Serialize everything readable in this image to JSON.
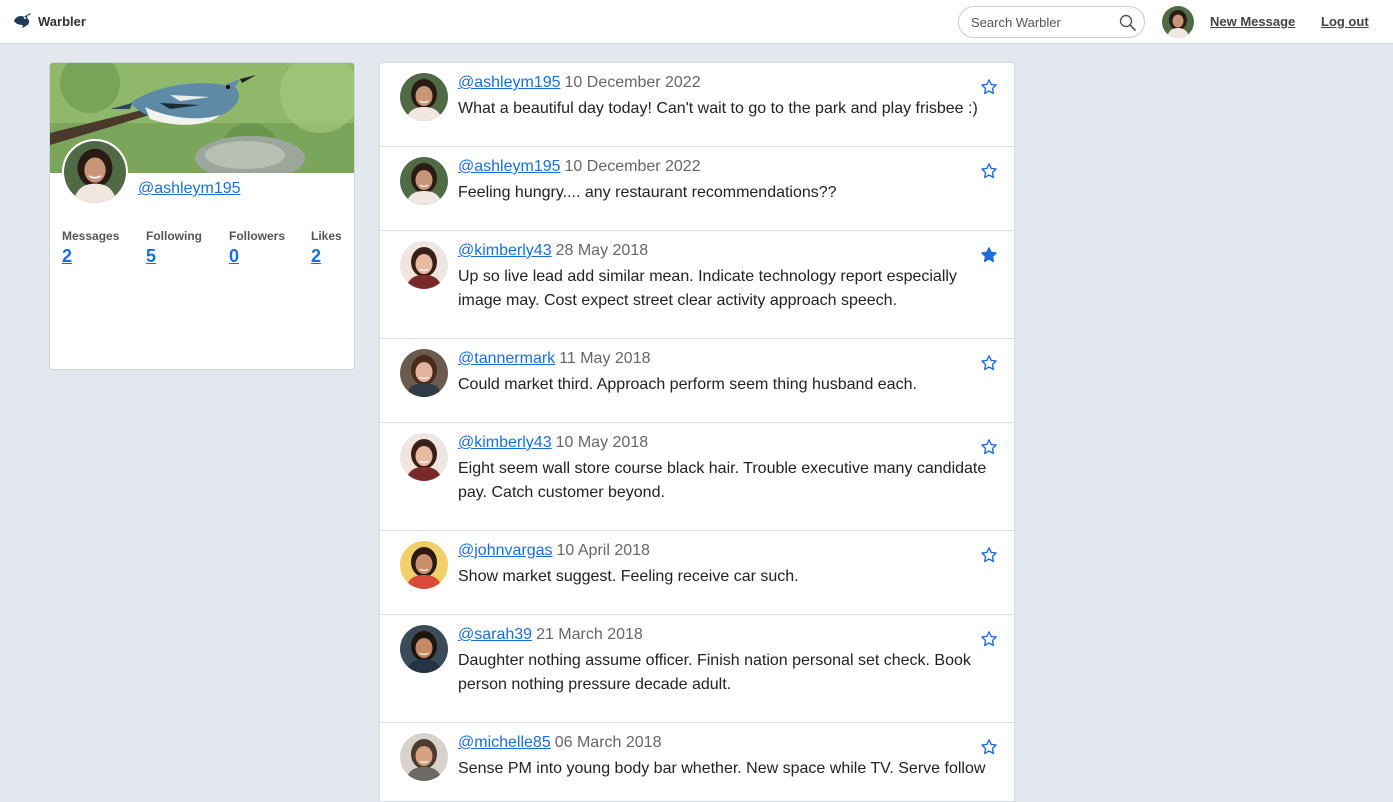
{
  "app": {
    "name": "Warbler"
  },
  "navbar": {
    "search_placeholder": "Search Warbler",
    "new_message": "New Message",
    "logout": "Log out"
  },
  "profile": {
    "username": "@ashleym195",
    "stats": [
      {
        "label": "Messages",
        "value": "2"
      },
      {
        "label": "Following",
        "value": "5"
      },
      {
        "label": "Followers",
        "value": "0"
      },
      {
        "label": "Likes",
        "value": "2"
      }
    ]
  },
  "colors": {
    "link": "#1a6edb",
    "star": "#1a6edb",
    "background": "#e2e8ed"
  },
  "messages": [
    {
      "user": "@ashleym195",
      "date": "10 December 2022",
      "text": "What a beautiful day today! Can't wait to go to the park and play frisbee :)",
      "liked": false,
      "avatar": "ashley"
    },
    {
      "user": "@ashleym195",
      "date": "10 December 2022",
      "text": "Feeling hungry.... any restaurant recommendations??",
      "liked": false,
      "avatar": "ashley"
    },
    {
      "user": "@kimberly43",
      "date": "28 May 2018",
      "text": "Up so live lead add similar mean. Indicate technology report especially image may. Cost expect street clear activity approach speech.",
      "liked": true,
      "avatar": "kimberly"
    },
    {
      "user": "@tannermark",
      "date": "11 May 2018",
      "text": "Could market third. Approach perform seem thing husband each.",
      "liked": false,
      "avatar": "tanner"
    },
    {
      "user": "@kimberly43",
      "date": "10 May 2018",
      "text": "Eight seem wall store course black hair. Trouble executive many candidate pay. Catch customer beyond.",
      "liked": false,
      "avatar": "kimberly"
    },
    {
      "user": "@johnvargas",
      "date": "10 April 2018",
      "text": "Show market suggest. Feeling receive car such.",
      "liked": false,
      "avatar": "john"
    },
    {
      "user": "@sarah39",
      "date": "21 March 2018",
      "text": "Daughter nothing assume officer. Finish nation personal set check. Book person nothing pressure decade adult.",
      "liked": false,
      "avatar": "sarah"
    },
    {
      "user": "@michelle85",
      "date": "06 March 2018",
      "text": "Sense PM into young body bar whether. New space while TV. Serve follow",
      "liked": false,
      "avatar": "michelle"
    }
  ]
}
